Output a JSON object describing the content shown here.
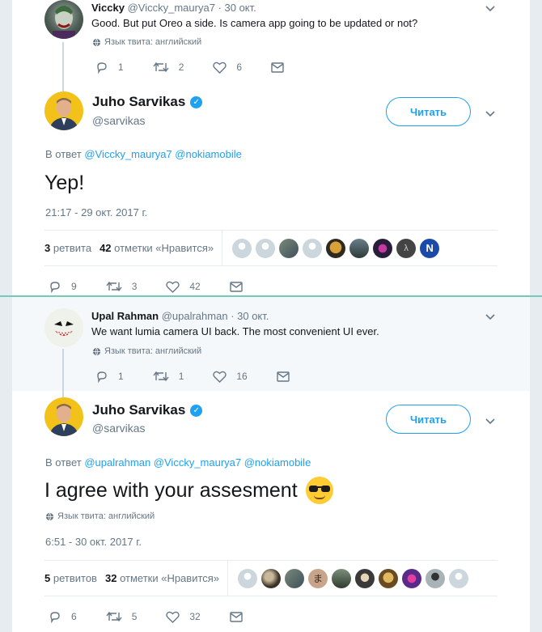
{
  "tweet1": {
    "name": "Viccky",
    "handle": "@Viccky_maurya7",
    "date": "· 30 окт.",
    "text": "Good. But put Oreo a side. Is camera app going to be updated or not?",
    "lang": "Язык твита: английский",
    "replies": "1",
    "retweets": "2",
    "likes": "6"
  },
  "main1": {
    "name": "Juho Sarvikas",
    "handle": "@sarvikas",
    "follow_label": "Читать",
    "reply_prefix": "В ответ",
    "reply_mentions": "@Viccky_maurya7 @nokiamobile",
    "text": "Yep!",
    "time": "21:17 - 29 окт. 2017 г.",
    "retweets_count": "3",
    "retweets_label": "ретвита",
    "likes_count": "42",
    "likes_label": "отметки «Нравится»",
    "replies": "9",
    "retweets": "3",
    "likes": "42"
  },
  "tweet2": {
    "name": "Upal Rahman",
    "handle": "@upalrahman",
    "date": "· 30 окт.",
    "text": "We want lumia camera UI back. The most convenient UI ever.",
    "lang": "Язык твита: английский",
    "replies": "1",
    "retweets": "1",
    "likes": "16"
  },
  "main2": {
    "name": "Juho Sarvikas",
    "handle": "@sarvikas",
    "follow_label": "Читать",
    "reply_prefix": "В ответ",
    "reply_mentions": "@upalrahman @Viccky_maurya7 @nokiamobile",
    "text": "I agree with your assesment",
    "lang": "Язык твита: английский",
    "time": "6:51 - 30 окт. 2017 г.",
    "retweets_count": "5",
    "retweets_label": "ретвитов",
    "likes_count": "32",
    "likes_label": "отметки «Нравится»",
    "replies": "6",
    "retweets": "5",
    "likes": "32"
  },
  "colors": {
    "link": "#1da1f2",
    "muted": "#657786",
    "divider": "#76c9b5"
  }
}
